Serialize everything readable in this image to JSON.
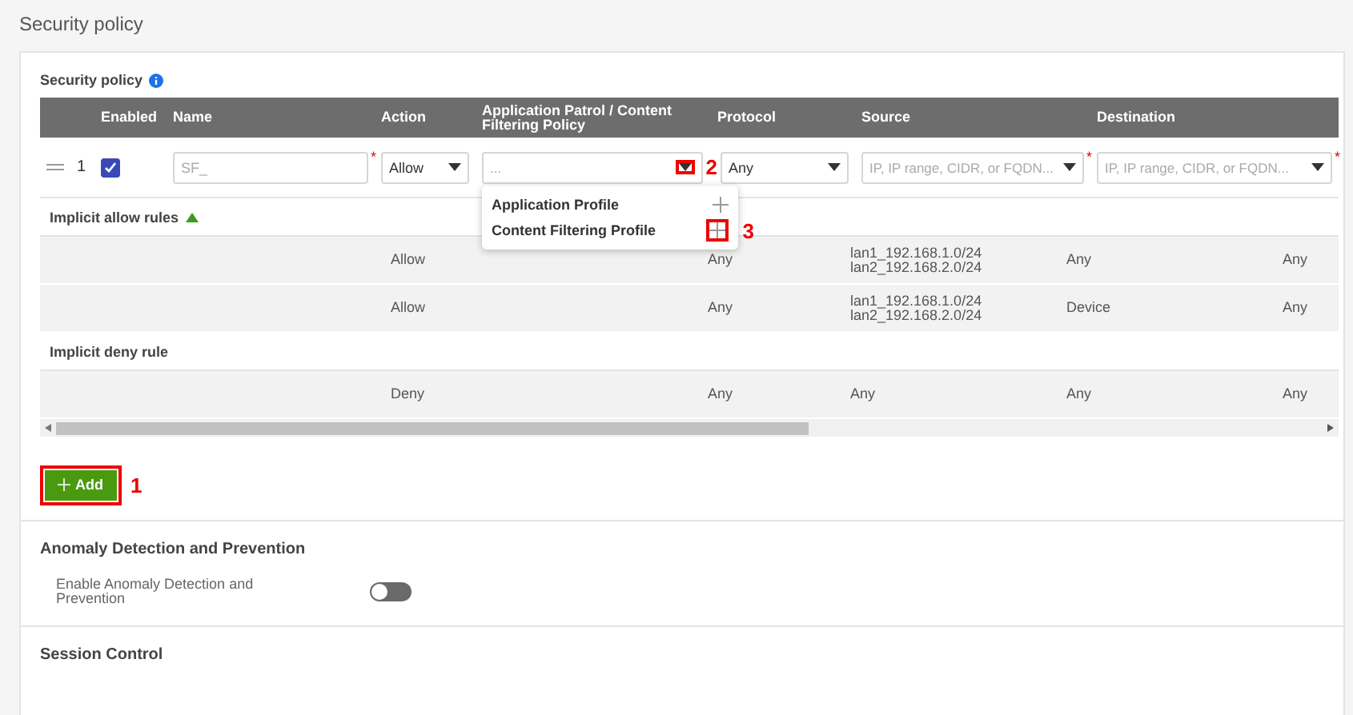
{
  "page_title": "Security policy",
  "card": {
    "title": "Security policy",
    "columns": [
      "Enabled",
      "Name",
      "Action",
      "Application Patrol / Content Filtering Policy",
      "Protocol",
      "Source",
      "Destination"
    ],
    "policy_rows": [
      {
        "number": "1",
        "enabled": true,
        "name": {
          "placeholder": "SF_",
          "mark": "*"
        },
        "action": "Allow",
        "app_policy": {
          "placeholder": "...",
          "callout": "2"
        },
        "protocol": "Any",
        "source": {
          "placeholder": "IP, IP range, CIDR, or FQDN...",
          "mark": "*"
        },
        "destination": {
          "placeholder": "IP, IP range, CIDR, or FQDN...",
          "mark": "*"
        }
      }
    ],
    "dropdown": [
      {
        "label": "Application Profile"
      },
      {
        "label": "Content Filtering Profile",
        "callout": "3"
      }
    ],
    "groups": [
      {
        "label": "Implicit allow rules",
        "expanded": true,
        "rows": [
          [
            "Allow",
            "Any",
            [
              "lan1_192.168.1.0/24",
              "lan2_192.168.2.0/24"
            ],
            "Any",
            "Any"
          ],
          [
            "Allow",
            "Any",
            [
              "lan1_192.168.1.0/24",
              "lan2_192.168.2.0/24"
            ],
            "Device",
            "Any"
          ]
        ]
      },
      {
        "label": "Implicit deny rule",
        "rows": [
          [
            "Deny",
            "Any",
            [
              "Any"
            ],
            "Any",
            "Any"
          ]
        ]
      }
    ],
    "add_button": {
      "label": "Add",
      "callout": "1"
    }
  },
  "anomaly": {
    "title": "Anomaly Detection and Prevention",
    "toggle_label": "Enable Anomaly Detection and Prevention",
    "on": false
  },
  "session": {
    "title": "Session Control"
  }
}
